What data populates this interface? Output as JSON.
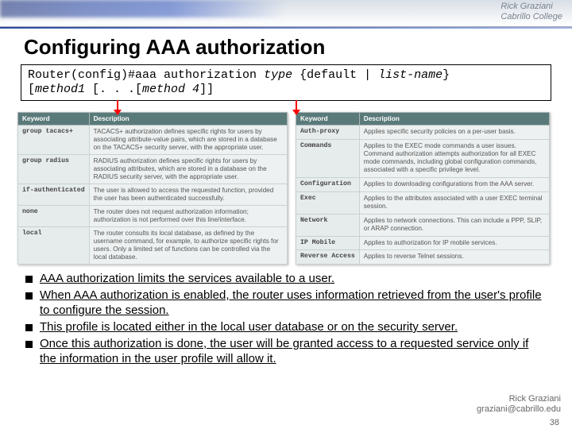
{
  "banner": {
    "name": "Rick Graziani",
    "college": "Cabrillo College"
  },
  "title": "Configuring AAA authorization",
  "syntax": {
    "line1_a": "Router(config)#aaa authorization ",
    "line1_b": "type",
    "line1_c": " {default | ",
    "line1_d": "list-name",
    "line1_e": "}",
    "line2_a": "   [",
    "line2_b": "method1",
    "line2_c": " [. . .[",
    "line2_d": "method 4",
    "line2_e": "]]"
  },
  "table_left": {
    "headers": [
      "Keyword",
      "Description"
    ],
    "rows": [
      [
        "group tacacs+",
        "TACACS+ authorization defines specific rights for users by associating attribute-value pairs, which are stored in a database on the TACACS+ security server, with the appropriate user."
      ],
      [
        "group radius",
        "RADIUS authorization defines specific rights for users by associating attributes, which are stored in a database on the RADIUS security server, with the appropriate user."
      ],
      [
        "if-authenticated",
        "The user is allowed to access the requested function, provided the user has been authenticated successfully."
      ],
      [
        "none",
        "The router does not request authorization information; authorization is not performed over this line/interface."
      ],
      [
        "local",
        "The router consults its local database, as defined by the username command, for example, to authorize specific rights for users. Only a limited set of functions can be controlled via the local database."
      ]
    ]
  },
  "table_right": {
    "headers": [
      "Keyword",
      "Description"
    ],
    "rows": [
      [
        "Auth-proxy",
        "Applies specific security policies on a per-user basis."
      ],
      [
        "Commands",
        "Applies to the EXEC mode commands a user issues. Command authorization attempts authorization for all EXEC mode commands, including global configuration commands, associated with a specific privilege level."
      ],
      [
        "Configuration",
        "Applies to downloading configurations from the AAA server."
      ],
      [
        "Exec",
        "Applies to the attributes associated with a user EXEC terminal session."
      ],
      [
        "Network",
        "Applies to network connections. This can include a PPP, SLIP, or ARAP connection."
      ],
      [
        "IP Mobile",
        "Applies to authorization for IP mobile services."
      ],
      [
        "Reverse Access",
        "Applies to reverse Telnet sessions."
      ]
    ]
  },
  "bullets": [
    "AAA authorization limits the services available to a user.",
    "When AAA authorization is enabled, the router uses information retrieved from the user's profile to configure the session.",
    "This profile is located either in the local user database or on the security server.",
    "Once this authorization is done, the user will be granted access to a requested service only if the information in the user profile will allow it."
  ],
  "footer": {
    "name": "Rick Graziani",
    "email": "graziani@cabrillo.edu",
    "page": "38"
  }
}
